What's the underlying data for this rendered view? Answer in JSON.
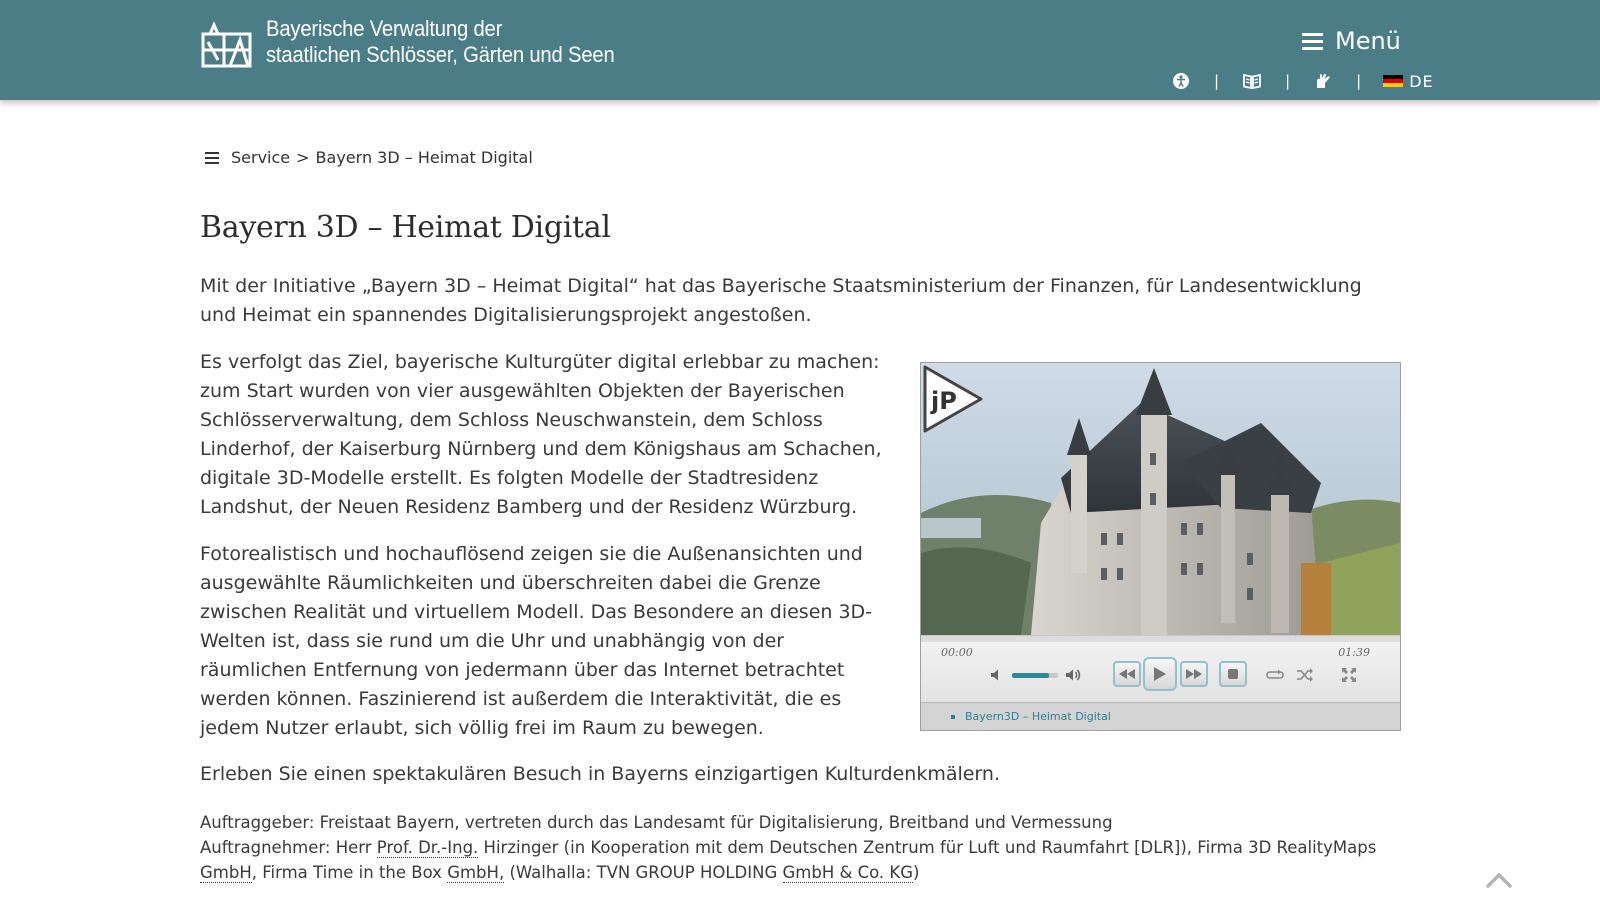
{
  "header": {
    "brand_line1": "Bayerische Verwaltung der",
    "brand_line2": "staatlichen Schlösser, Gärten und Seen",
    "menu_label": "Menü",
    "tools": {
      "accessibility_icon": "accessibility-icon",
      "easy_language_icon": "book-icon",
      "sign_language_icon": "sign-language-icon",
      "separator": "|",
      "language_code": "DE"
    },
    "colors": {
      "background": "#4a7d86",
      "text": "#ffffff"
    }
  },
  "breadcrumb": {
    "items": [
      "Service",
      "Bayern 3D – Heimat Digital"
    ],
    "separator": ">"
  },
  "page_title": "Bayern 3D – Heimat Digital",
  "content": {
    "intro": "Mit der Initiative „Bayern 3D – Heimat Digital“ hat das Bayerische Staatsministerium der Finanzen, für Landesentwicklung und Heimat ein spannendes Digitalisierungsprojekt angestoßen.",
    "paragraph_1": "Es verfolgt das Ziel, bayerische Kulturgüter digital erlebbar zu machen: zum Start wurden von vier ausgewählten Objekten der Bayerischen Schlösserverwaltung, dem Schloss Neuschwanstein, dem Schloss Linderhof, der Kaiserburg Nürnberg und dem Königshaus am Schachen, digitale 3D-Modelle erstellt. Es folgten Modelle der Stadtresidenz Landshut, der Neuen Residenz Bamberg und der Residenz Würzburg.",
    "paragraph_2": "Fotorealistisch und hochauflösend zeigen sie die Außenansichten und ausgewählte Räumlichkeiten und überschreiten dabei die Grenze zwischen Realität und virtuellem Modell. Das Besondere an diesen 3D-Welten ist, dass sie rund um die Uhr und unabhängig von der räumlichen Entfernung von jedermann über das Internet betrachtet werden können. Faszinierend ist außerdem die Interaktivität, die es jedem Nutzer erlaubt, sich völlig frei im Raum zu bewegen.",
    "paragraph_3": "Erleben Sie einen spektakulären Besuch in Bayerns einzigartigen Kulturdenkmälern."
  },
  "credits": {
    "client_label": "Auftraggeber:",
    "client": "Freistaat Bayern, vertreten durch das Landesamt für Digitalisierung, Breitband und Vermessung",
    "contractor_label": "Auftragnehmer:",
    "contractor_prefix": "Herr",
    "title_abbr": "Prof. Dr.-Ing.",
    "contractor_mid": "Hirzinger (in Kooperation mit dem Deutschen Zentrum für Luft und Raumfahrt [DLR]), Firma 3D RealityMaps",
    "gmbh_1": "GmbH",
    "contractor_firm2": ", Firma Time in the Box",
    "gmbh_2": "GmbH,",
    "contractor_walhalla": " (Walhalla: TVN GROUP HOLDING",
    "gmbh_co_kg": "GmbH & Co. KG",
    "closing": ")"
  },
  "player": {
    "current_time": "00:00",
    "duration": "01:39",
    "volume": 0.8,
    "progress": 0,
    "playlist": [
      "Bayern3D – Heimat Digital"
    ],
    "accent": "#2f8a96"
  }
}
